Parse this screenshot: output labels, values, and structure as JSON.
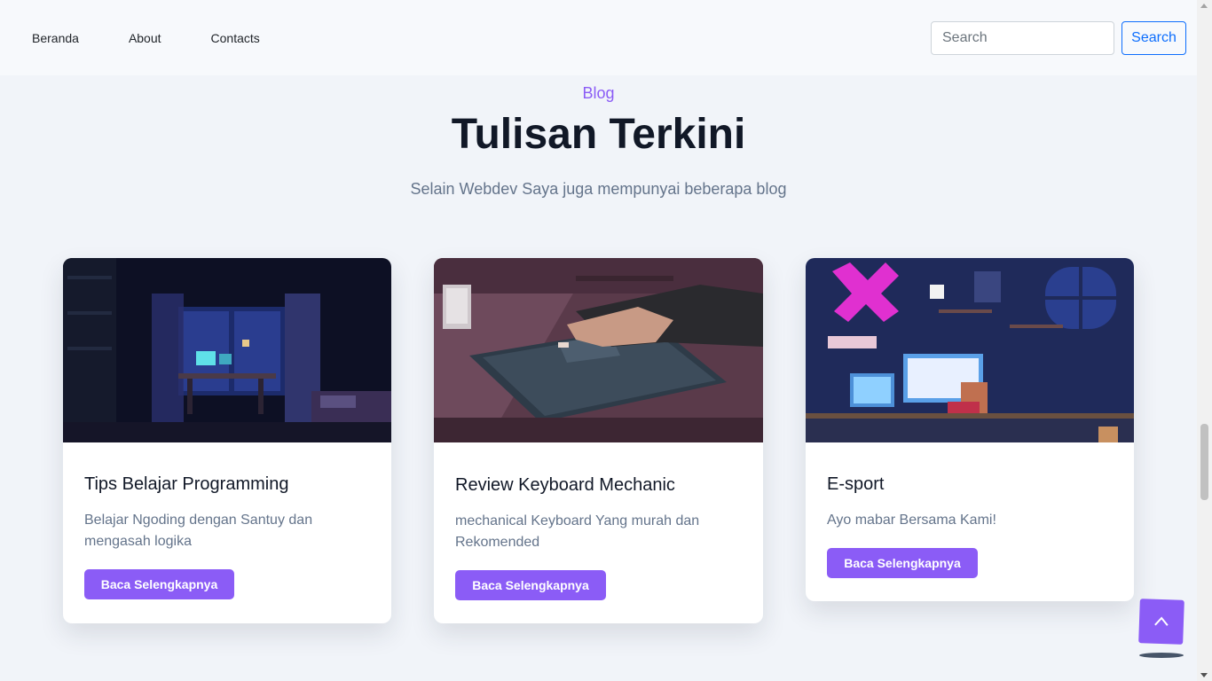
{
  "nav": {
    "links": [
      "Beranda",
      "About",
      "Contacts"
    ],
    "search_placeholder": "Search",
    "search_button": "Search"
  },
  "section": {
    "label": "Blog",
    "title": "Tulisan Terkini",
    "subtitle": "Selain Webdev Saya juga mempunyai beberapa blog"
  },
  "cards": [
    {
      "title": "Tips Belajar Programming",
      "text": "Belajar Ngoding dengan Santuy dan mengasah logika",
      "button": "Baca Selengkapnya",
      "image": "pixel-art-night-room"
    },
    {
      "title": "Review Keyboard Mechanic",
      "text": "mechanical Keyboard Yang murah dan Rekomended",
      "button": "Baca Selengkapnya",
      "image": "pixel-art-keyboard-hand"
    },
    {
      "title": "E-sport",
      "text": "Ayo mabar Bersama Kami!",
      "button": "Baca Selengkapnya",
      "image": "pixel-art-gaming-room"
    }
  ],
  "back_to_top_icon": "chevron-up-icon",
  "colors": {
    "accent": "#8b5cf6",
    "nav_bg": "#f7f9fc",
    "page_bg": "#f1f4f9",
    "search_blue": "#0d6efd"
  }
}
